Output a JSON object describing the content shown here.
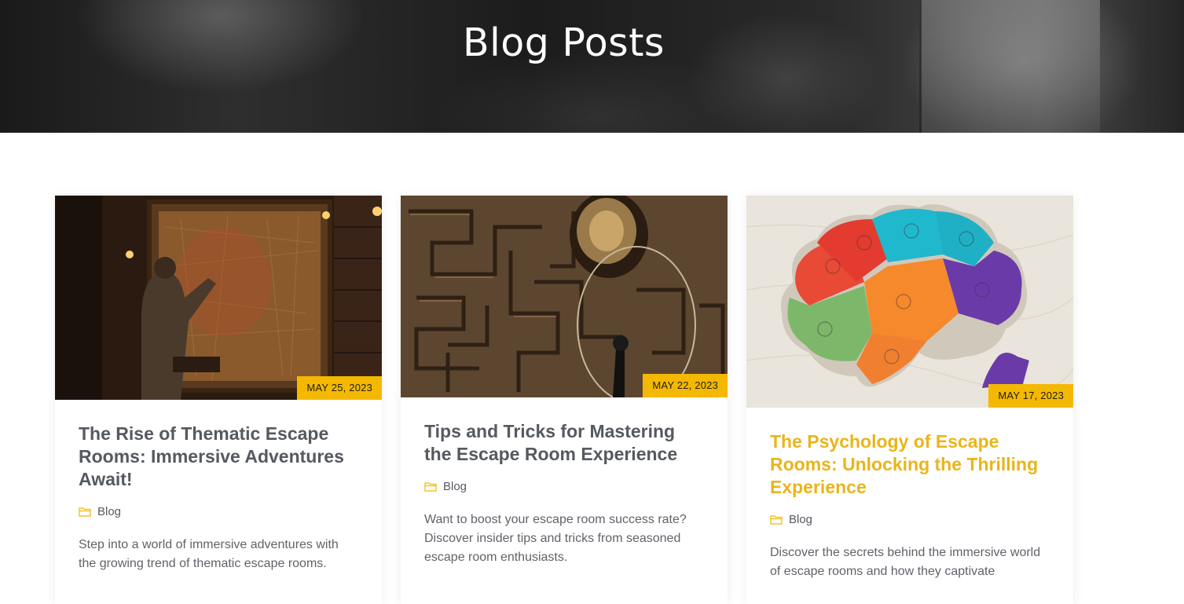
{
  "header": {
    "title": "Blog Posts"
  },
  "theme": {
    "accent": "#f5b800",
    "active_title": "#e9b51a",
    "title_text": "#555a60",
    "body_text": "#5f6369"
  },
  "posts": [
    {
      "date": "MAY 25, 2023",
      "title": "The Rise of Thematic Escape Rooms: Immersive Adventures Await!",
      "category": "Blog",
      "category_icon": "folder-icon",
      "excerpt": "Step into a world of immersive adventures with the growing trend of thematic escape rooms."
    },
    {
      "date": "MAY 22, 2023",
      "title": "Tips and Tricks for Mastering the Escape Room Experience",
      "category": "Blog",
      "category_icon": "folder-icon",
      "excerpt": "Want to boost your escape room success rate? Discover insider tips and tricks from seasoned escape room enthusiasts."
    },
    {
      "date": "MAY 17, 2023",
      "title": "The Psychology of Escape Rooms: Unlocking the Thrilling Experience",
      "category": "Blog",
      "category_icon": "folder-icon",
      "excerpt": "Discover the secrets behind the immersive world of escape rooms and how they captivate"
    }
  ]
}
